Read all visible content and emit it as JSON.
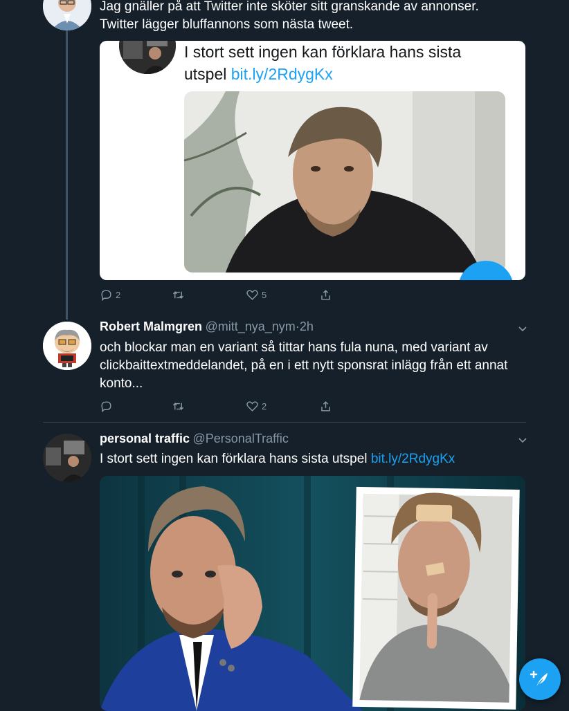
{
  "tweet1": {
    "text_line1": "Jag gnäller på att Twitter inte sköter sitt granskande av annonser.",
    "text_line2": "Twitter lägger bluffannons som nästa tweet.",
    "embedded": {
      "text_line1": "I stort sett ingen kan förklara hans sista",
      "text_prefix": "utspel ",
      "link": "bit.ly/2RdygKx"
    },
    "actions": {
      "replies": "2",
      "retweets": "",
      "likes": "5"
    }
  },
  "tweet2": {
    "name": "Robert Malmgren",
    "handle": "@mitt_nya_nym",
    "separator": "·",
    "time": "2h",
    "text_line1": "och blockar man en variant så tittar hans fula nuna, med variant av",
    "text_line2": "clickbaittextmeddelandet, på en i ett nytt sponsrat inlägg från ett annat",
    "text_line3": "konto...",
    "actions": {
      "replies": "",
      "retweets": "",
      "likes": "2"
    }
  },
  "tweet3": {
    "name": "personal traffic",
    "handle": "@PersonalTraffic",
    "text_prefix": "I stort sett ingen kan förklara hans sista utspel ",
    "link": "bit.ly/2RdygKx"
  },
  "icons": {
    "reply": "reply-icon",
    "retweet": "retweet-icon",
    "like": "heart-icon",
    "share": "share-icon",
    "more": "chevron-down-icon",
    "compose": "compose-tweet-icon"
  },
  "colors": {
    "background": "#15202b",
    "accent": "#1da1f2",
    "muted": "#8899a6",
    "divider": "#38444d"
  }
}
